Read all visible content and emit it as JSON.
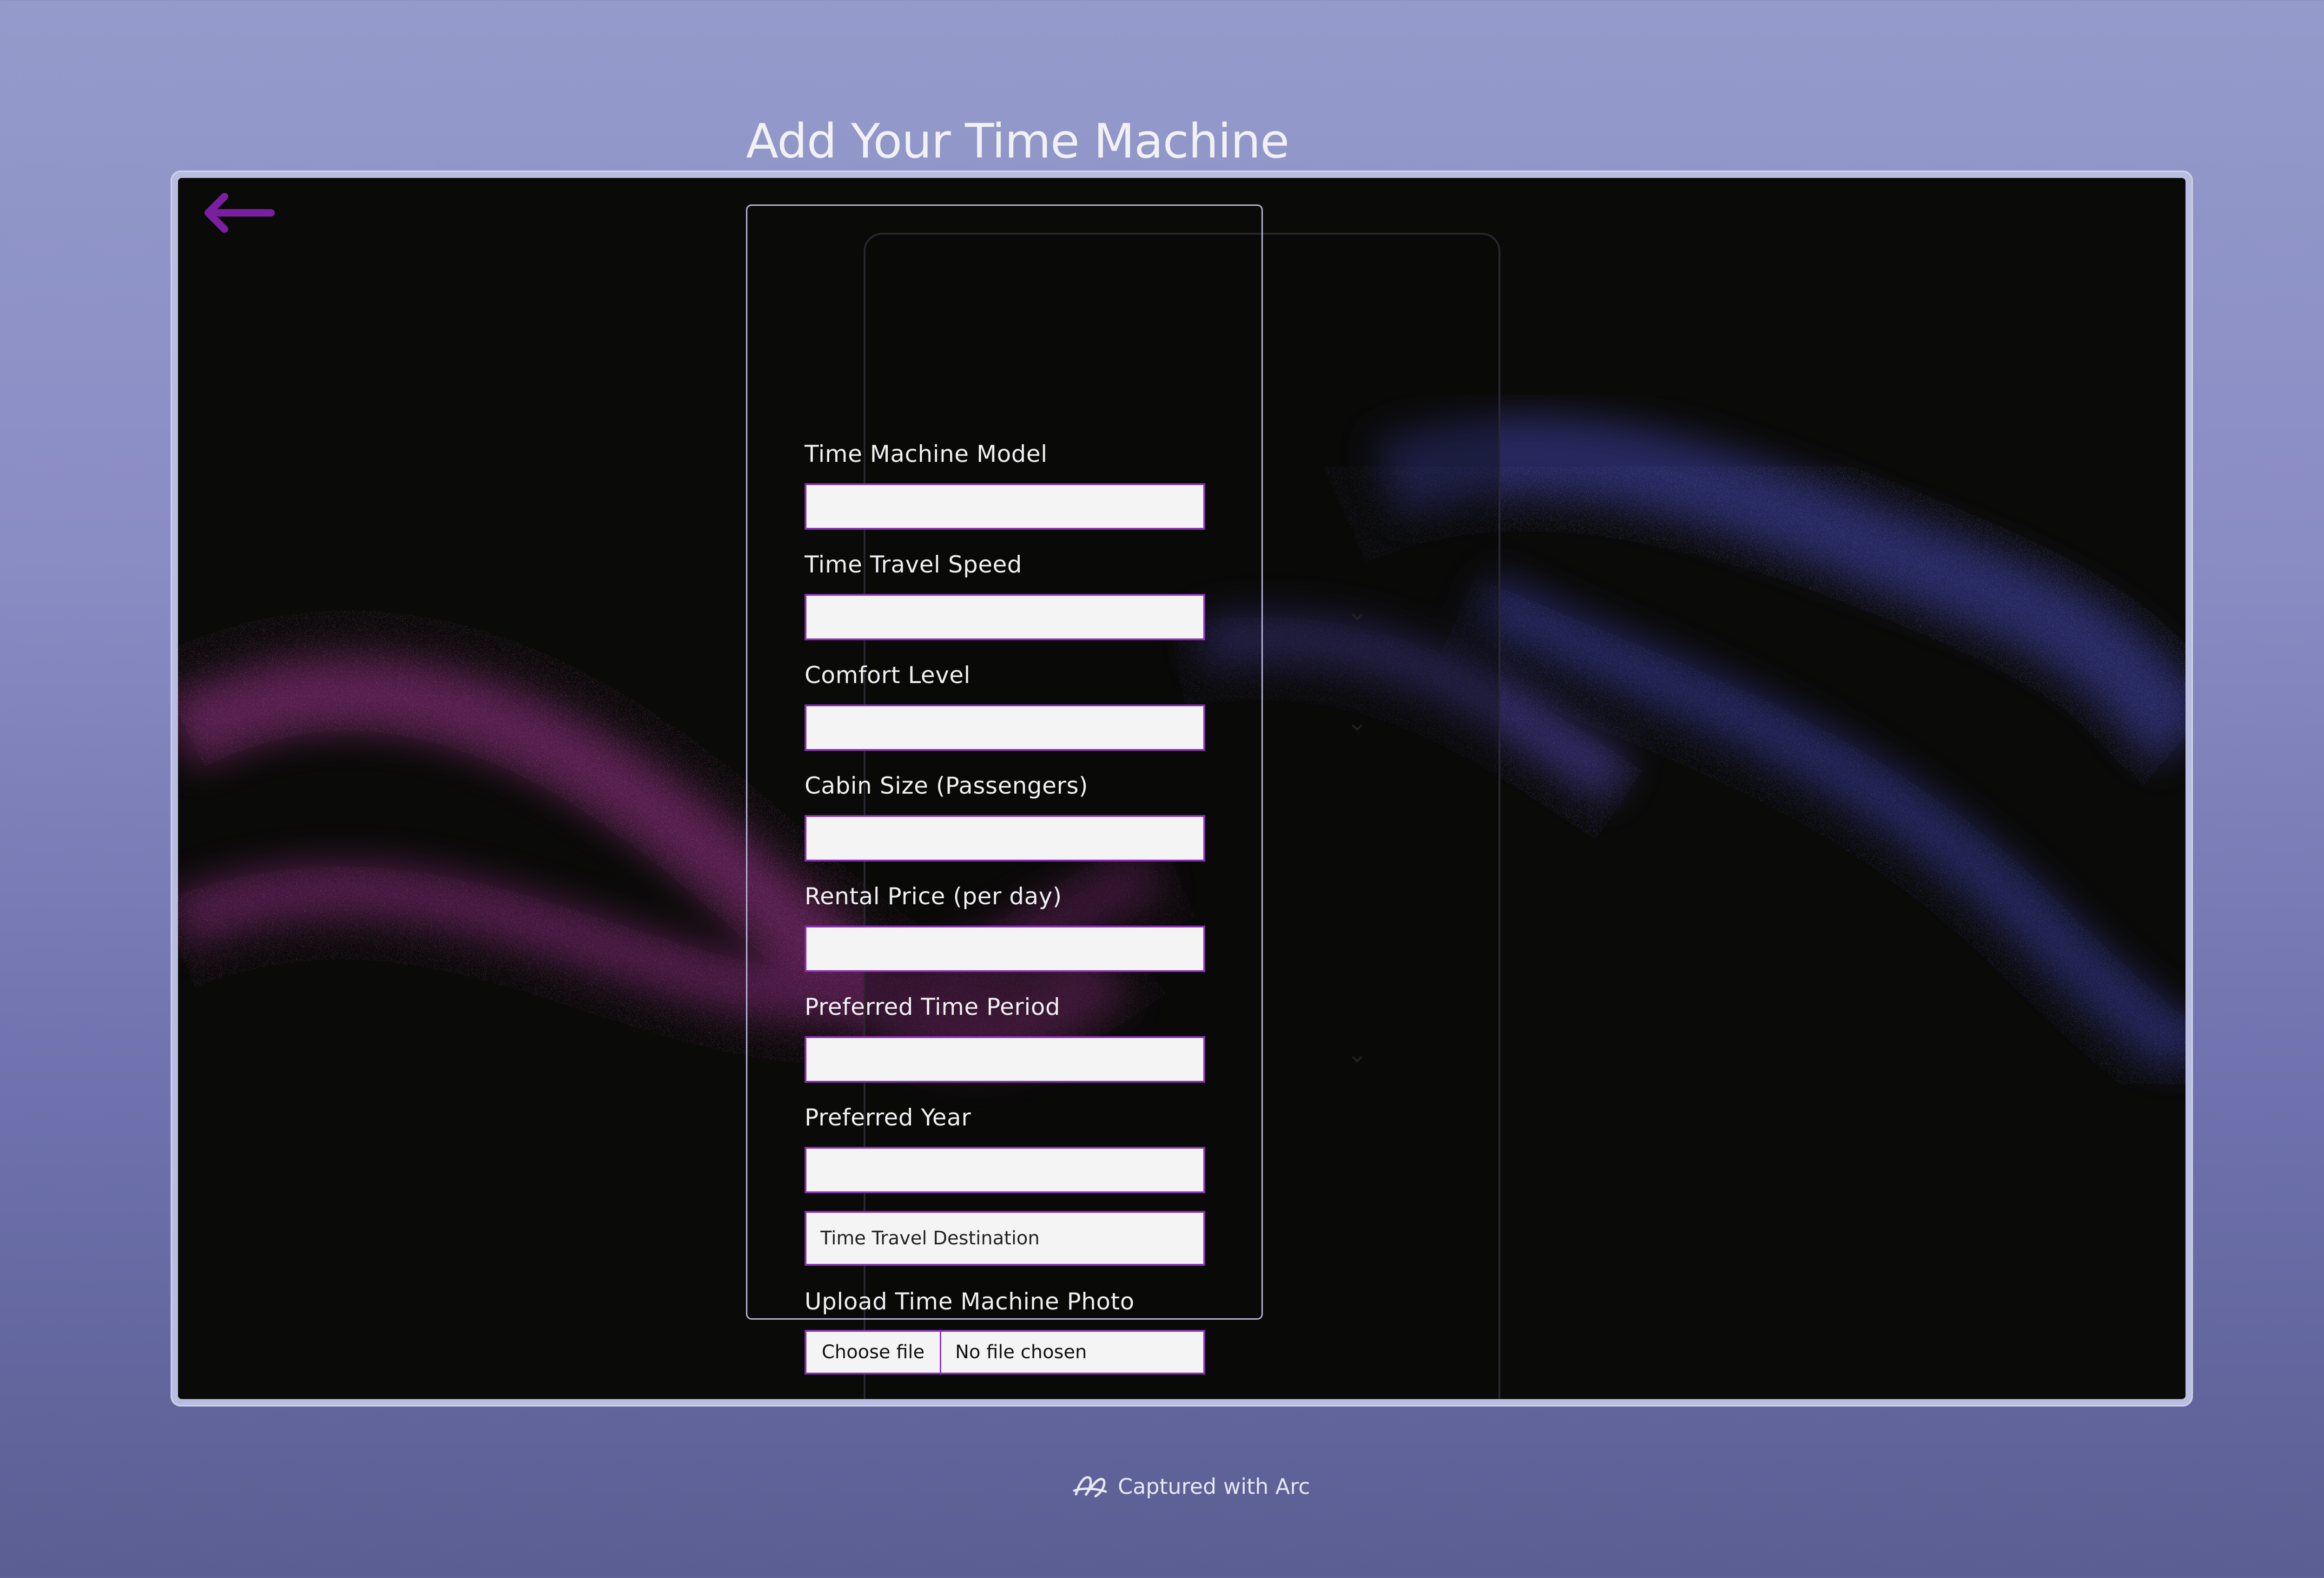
{
  "page": {
    "title": "Add Your Time Machine",
    "back_icon": "arrow-left-icon"
  },
  "form": {
    "fields": [
      {
        "label": "Time Machine Model",
        "type": "text",
        "value": ""
      },
      {
        "label": "Time Travel Speed",
        "type": "select",
        "value": ""
      },
      {
        "label": "Comfort Level",
        "type": "select",
        "value": ""
      },
      {
        "label": "Cabin Size (Passengers)",
        "type": "text",
        "value": ""
      },
      {
        "label": "Rental Price (per day)",
        "type": "text",
        "value": ""
      },
      {
        "label": "Preferred Time Period",
        "type": "select",
        "value": ""
      },
      {
        "label": "Preferred Year",
        "type": "text",
        "value": ""
      }
    ],
    "destination": {
      "placeholder": "Time Travel Destination",
      "value": ""
    },
    "upload": {
      "label": "Upload Time Machine Photo",
      "button_label": "Choose file",
      "status": "No file chosen"
    }
  },
  "footer": {
    "text": "Captured with Arc",
    "icon": "arc-logo-icon"
  },
  "colors": {
    "accent": "#8a2fb4",
    "back_arrow": "#7b1fa2",
    "input_bg": "#f4f4f4",
    "page_bg": "#0a0a08"
  }
}
